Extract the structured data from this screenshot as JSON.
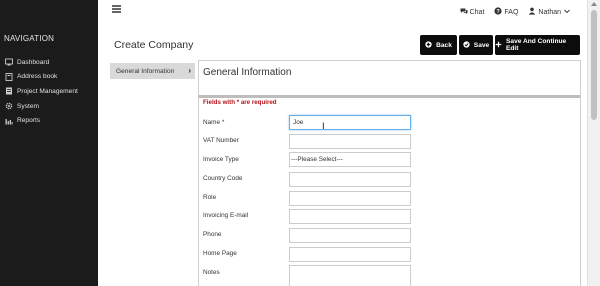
{
  "sidebar": {
    "title": "NAVIGATION",
    "items": [
      {
        "label": "Dashboard",
        "icon": "dashboard-icon"
      },
      {
        "label": "Address book",
        "icon": "address-book-icon"
      },
      {
        "label": "Project Management",
        "icon": "project-icon"
      },
      {
        "label": "System",
        "icon": "gear-icon"
      },
      {
        "label": "Reports",
        "icon": "bar-chart-icon"
      }
    ]
  },
  "topbar": {
    "chat": "Chat",
    "faq": "FAQ",
    "user": "Nathan"
  },
  "page": {
    "title": "Create Company",
    "buttons": {
      "back": "Back",
      "save": "Save",
      "save_continue": "Save And Continue Edit"
    },
    "tab": "General Information"
  },
  "form": {
    "title": "General Information",
    "required_note": "Fields with * are required",
    "fields": [
      {
        "label": "Name *",
        "value": ""
      },
      {
        "label": "VAT Number",
        "value": ""
      },
      {
        "label": "Invoice Type",
        "value": "---Please Select---"
      },
      {
        "label": "Country Code",
        "value": ""
      },
      {
        "label": "Role",
        "value": ""
      },
      {
        "label": "Invoicing E-mail",
        "value": ""
      },
      {
        "label": "Phone",
        "value": ""
      },
      {
        "label": "Home Page",
        "value": ""
      },
      {
        "label": "Notes",
        "value": ""
      }
    ],
    "name_value": "Joe",
    "invoice_type_option": "---Please Select---"
  },
  "colors": {
    "sidebar_bg": "#1b1b1b",
    "button_bg": "#0c0c0c",
    "required_text": "#b2141b",
    "focus_border": "#66afe9"
  }
}
